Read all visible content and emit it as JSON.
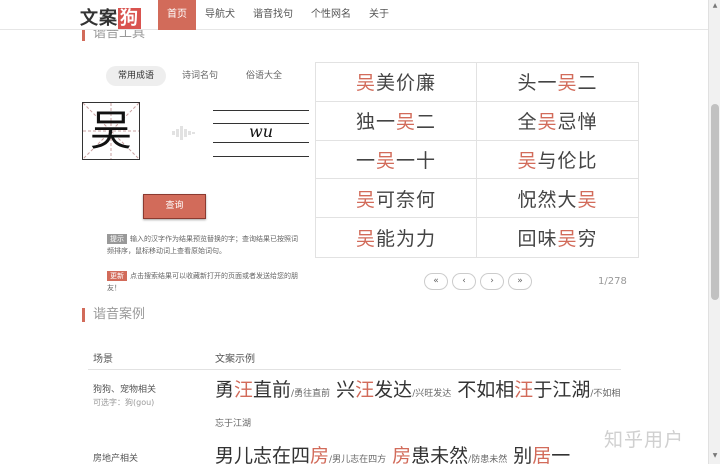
{
  "logo": {
    "text_main": "文案",
    "text_accent": "狗"
  },
  "nav": [
    "首页",
    "导航犬",
    "谐音找句",
    "个性网名",
    "关于"
  ],
  "section_top": "谐音工具",
  "tabs": [
    "常用成语",
    "诗词名句",
    "俗语大全"
  ],
  "tool": {
    "character": "吴",
    "pinyin": "wu",
    "query_label": "查询"
  },
  "tips": [
    {
      "badge": "提示",
      "text": "输入的汉字作为结果预览替换的字；查询结果已按照词频排序，鼠标移动词上查看原始词句。"
    },
    {
      "badge": "更新",
      "text": "点击搜索结果可以收藏新打开的页面或者发送给您的朋友！"
    }
  ],
  "idioms": [
    {
      "pre": "",
      "hl": "吴",
      "post": "美价廉"
    },
    {
      "pre": "头一",
      "hl": "吴",
      "post": "二"
    },
    {
      "pre": "独一",
      "hl": "吴",
      "post": "二"
    },
    {
      "pre": "全",
      "hl": "吴",
      "post": "忌惮"
    },
    {
      "pre": "一",
      "hl": "吴",
      "post": "一十"
    },
    {
      "pre": "",
      "hl": "吴",
      "post": "与伦比"
    },
    {
      "pre": "",
      "hl": "吴",
      "post": "可奈何"
    },
    {
      "pre": "怳然大",
      "hl": "吴",
      "post": ""
    },
    {
      "pre": "",
      "hl": "吴",
      "post": "能为力"
    },
    {
      "pre": "回味",
      "hl": "吴",
      "post": "穷"
    }
  ],
  "pager": {
    "first": "«",
    "prev": "‹",
    "next": "›",
    "last": "»",
    "count": "1/278"
  },
  "section_cases": "谐音案例",
  "case_headers": {
    "scene": "场景",
    "example": "文案示例"
  },
  "cases": [
    {
      "scene": "狗狗、宠物相关",
      "sub": "可选字：狗(gou)",
      "items": [
        {
          "pre": "勇",
          "hl": "汪",
          "post": "直前",
          "note": "/勇往直前"
        },
        {
          "pre": "兴",
          "hl": "汪",
          "post": "发达",
          "note": "/兴旺发达"
        },
        {
          "pre": "不如相",
          "hl": "汪",
          "post": "于江湖",
          "note": "/不如相忘于江湖"
        }
      ]
    },
    {
      "scene": "房地产相关",
      "sub": "",
      "items": [
        {
          "pre": "男儿志在四",
          "hl": "房",
          "post": "",
          "note": "/男儿志在四方"
        },
        {
          "pre": "",
          "hl": "房",
          "post": "患未然",
          "note": "/防患未然"
        },
        {
          "pre": "别",
          "hl": "居",
          "post": "一",
          "note": ""
        }
      ]
    }
  ],
  "watermark": "知乎用户"
}
